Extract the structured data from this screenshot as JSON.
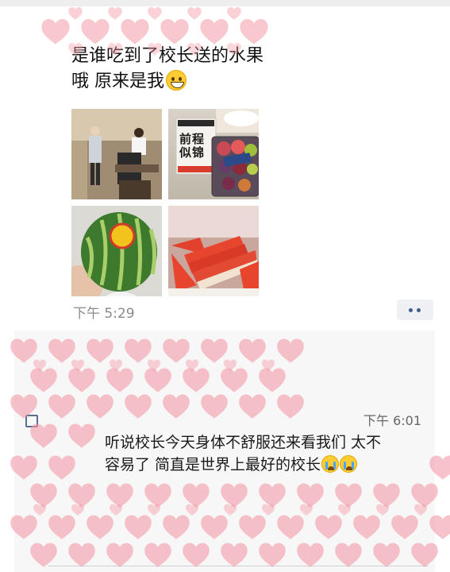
{
  "moment_1": {
    "text_line_1": "是谁吃到了校长送的水果",
    "text_line_2": "哦 原来是我",
    "emoji": "grinning-face",
    "photos": [
      {
        "name": "photo-meeting-room"
      },
      {
        "name": "photo-fruit-gift-box"
      },
      {
        "name": "photo-whole-watermelon"
      },
      {
        "name": "photo-watermelon-slices"
      }
    ],
    "gift_box_label": "前程似锦",
    "time": "下午 5:29"
  },
  "moment_2": {
    "time": "下午 6:01",
    "comment_line_1": "听说校长今天身体不舒服还来看我们 太不",
    "comment_line_2": "容易了 简直是世界上最好的校长",
    "emoji": "loudly-crying-face"
  },
  "colors": {
    "background": "#ffffff",
    "panel": "#f7f7f7",
    "link_blue": "#3f5e8c",
    "timestamp": "#8a8a8a",
    "heart_sticker": "#f29aa6"
  }
}
